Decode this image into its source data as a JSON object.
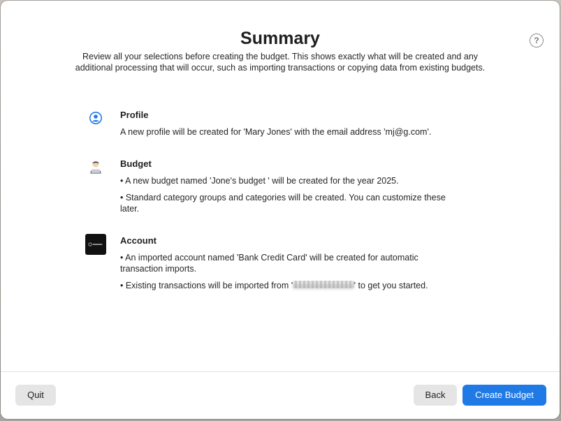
{
  "header": {
    "title": "Summary",
    "subtitle": "Review all your selections before creating the budget. This shows exactly what will be created and any additional processing that will occur, such as importing transactions or copying data from existing budgets.",
    "help_label": "?"
  },
  "sections": {
    "profile": {
      "heading": "Profile",
      "icon": "person-circle-icon",
      "lines": [
        "A new profile will be created for 'Mary Jones' with the email address 'mj@g.com'."
      ]
    },
    "budget": {
      "heading": "Budget",
      "icon": "person-at-laptop-icon",
      "lines": [
        "• A new budget named 'Jone's budget ' will be created for the year 2025.",
        "• Standard category groups and categories will be created. You can customize these later."
      ]
    },
    "account": {
      "heading": "Account",
      "icon": "bank-logo-icon",
      "line1": "• An imported account named 'Bank Credit Card' will be created for automatic transaction imports.",
      "line2_prefix": "• Existing transactions will be imported from '",
      "line2_redacted": "xxxxxxxxxxxxxx",
      "line2_suffix": "' to get you started."
    }
  },
  "footer": {
    "quit_label": "Quit",
    "back_label": "Back",
    "create_label": "Create Budget"
  },
  "colors": {
    "primary": "#1f7ae6",
    "secondary_button": "#e5e5e5",
    "icon_blue": "#1f7ae6"
  }
}
